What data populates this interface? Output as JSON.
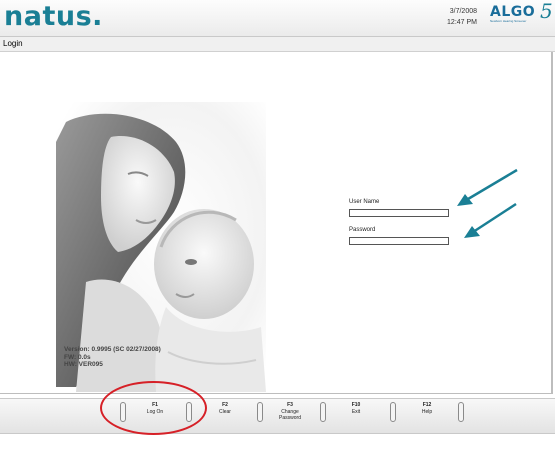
{
  "header": {
    "brand": "natus",
    "date": "3/7/2008",
    "time": "12:47 PM",
    "product_logo": "ALGO",
    "product_logo_number": "5",
    "product_tagline": "Newborn Hearing Screener"
  },
  "window": {
    "title": "Login"
  },
  "version": {
    "line1": "Version: 0.9995 (SC 02/27/2008)",
    "line2": "FW: 0.0s",
    "line3": "HW: VER095"
  },
  "form": {
    "username_label": "User Name",
    "username_value": "",
    "password_label": "Password",
    "password_value": ""
  },
  "function_keys": [
    {
      "key": "F1",
      "label": "Log On"
    },
    {
      "key": "F2",
      "label": "Clear"
    },
    {
      "key": "F3",
      "label": "Change Password"
    },
    {
      "key": "F10",
      "label": "Exit"
    },
    {
      "key": "F12",
      "label": "Help"
    }
  ],
  "colors": {
    "brand": "#1a7f95",
    "arrow": "#1a7f95",
    "highlight": "#d62027"
  }
}
